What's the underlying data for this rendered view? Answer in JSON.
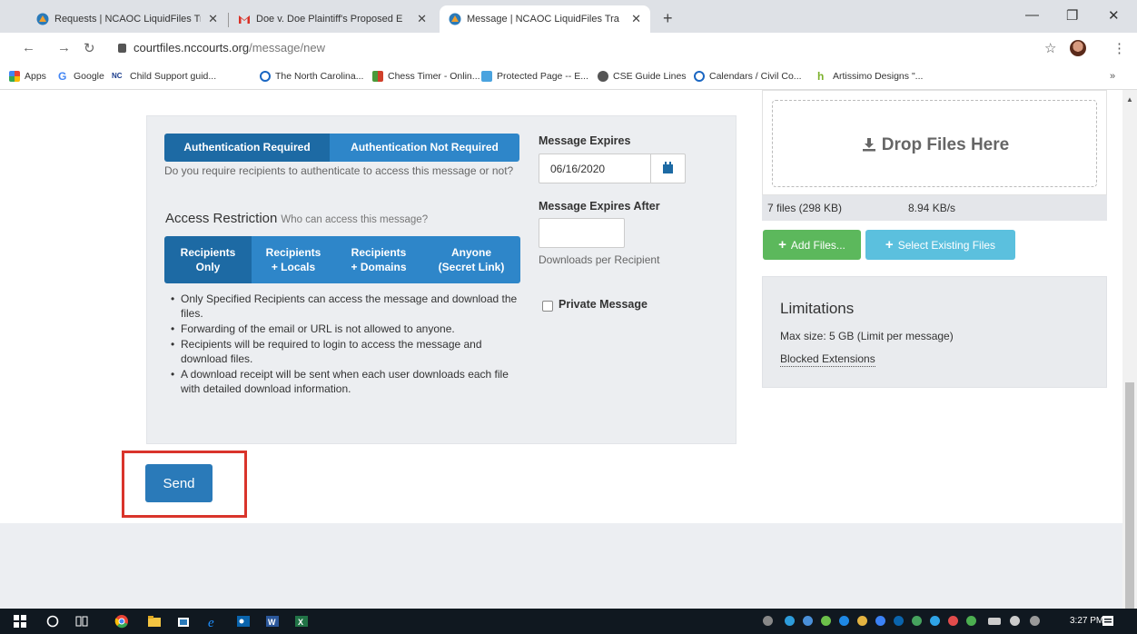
{
  "browser": {
    "tabs": [
      {
        "title": "Requests | NCAOC LiquidFiles Tra",
        "active": false
      },
      {
        "title": "Doe v. Doe Plaintiff's Proposed E",
        "active": false
      },
      {
        "title": "Message | NCAOC LiquidFiles Tra",
        "active": true
      }
    ],
    "new_tab": "+",
    "url_host": "courtfiles.nccourts.org",
    "url_path": "/message/new",
    "bookmarks": [
      "Apps",
      "Google",
      "Child Support guid...",
      "The North Carolina...",
      "Chess Timer - Onlin...",
      "Protected Page -- E...",
      "CSE Guide Lines",
      "Calendars / Civil Co...",
      "Artissimo Designs \"..."
    ],
    "bookmarks_more": "»"
  },
  "form": {
    "auth": {
      "options": [
        "Authentication Required",
        "Authentication Not Required"
      ],
      "selected": 0,
      "help": "Do you require recipients to authenticate to access this message or not?"
    },
    "access": {
      "title": "Access Restriction",
      "subtitle": "Who can access this message?",
      "options": [
        {
          "line1": "Recipients",
          "line2": "Only"
        },
        {
          "line1": "Recipients",
          "line2": "+ Locals"
        },
        {
          "line1": "Recipients",
          "line2": "+ Domains"
        },
        {
          "line1": "Anyone",
          "line2": "(Secret Link)"
        }
      ],
      "selected": 0,
      "bullets": [
        "Only Specified Recipients can access the message and download the files.",
        "Forwarding of the email or URL is not allowed to anyone.",
        "Recipients will be required to login to access the message and download files.",
        "A download receipt will be sent when each user downloads each file with detailed download information."
      ]
    },
    "expires": {
      "label": "Message Expires",
      "value": "06/16/2020"
    },
    "expires_after": {
      "label": "Message Expires After",
      "value": "",
      "help": "Downloads per Recipient"
    },
    "private_message": {
      "label": "Private Message",
      "checked": false
    },
    "send_label": "Send"
  },
  "files": {
    "drop_label": "Drop Files Here",
    "count_size": "7 files (298 KB)",
    "speed": "8.94 KB/s",
    "add_label": "Add Files...",
    "select_existing_label": "Select Existing Files"
  },
  "limitations": {
    "title": "Limitations",
    "max_size": "Max size: 5 GB (Limit per message)",
    "blocked": "Blocked Extensions"
  },
  "taskbar": {
    "time": "3:27 PM"
  },
  "colors": {
    "primary": "#1d6aa4",
    "primary_light": "#2e86c9",
    "success": "#5cb85c",
    "info": "#5bc0de",
    "highlight_box": "#d9342b"
  }
}
